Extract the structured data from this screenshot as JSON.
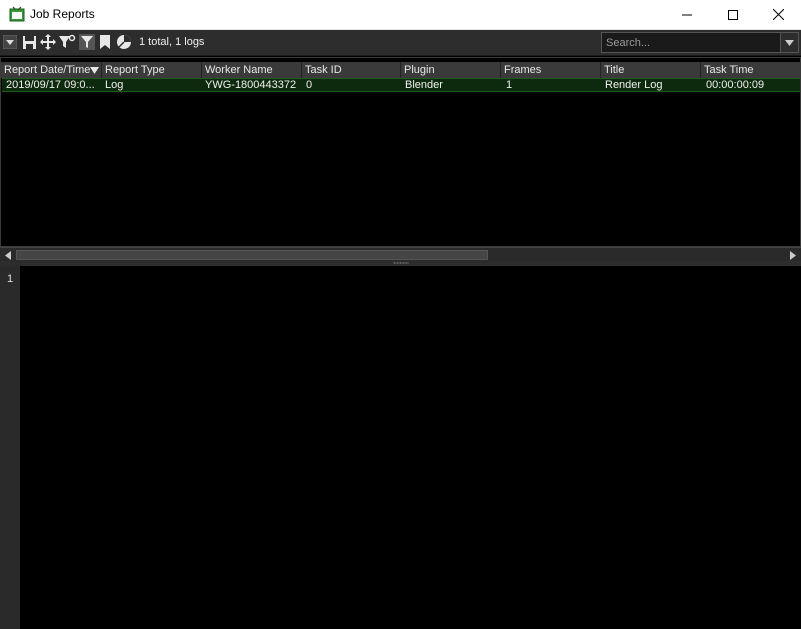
{
  "window": {
    "title": "Job Reports"
  },
  "toolbar": {
    "summary": "1 total, 1 logs",
    "icons": [
      "menu-dropdown-icon",
      "save-icon",
      "move-icon",
      "filter-settings-icon",
      "filter-icon",
      "bookmark-icon",
      "pie-chart-icon"
    ],
    "search_placeholder": "Search..."
  },
  "table": {
    "columns": [
      "Report Date/Time",
      "Report Type",
      "Worker Name",
      "Task ID",
      "Plugin",
      "Frames",
      "Title",
      "Task Time"
    ],
    "rows": [
      {
        "date_time": "2019/09/17 09:0...",
        "report_type": "Log",
        "worker_name": "YWG-1800443372",
        "task_id": "0",
        "plugin": "Blender",
        "frames": "1",
        "title": "Render Log",
        "task_time": "00:00:00:09"
      }
    ]
  },
  "log": {
    "line_numbers": [
      "1"
    ]
  },
  "colors": {
    "selected_row": "#0e2a0e",
    "app_icon": "#3a9a3a"
  }
}
